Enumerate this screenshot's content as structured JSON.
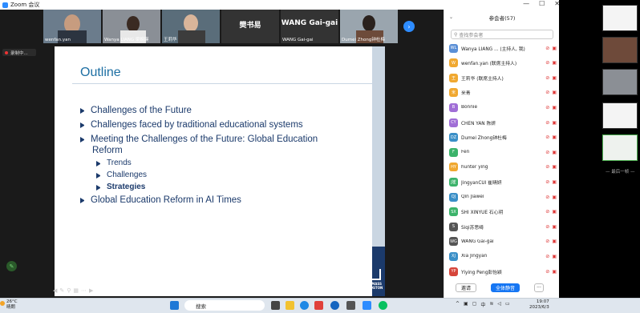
{
  "window": {
    "title": "Zoom 会议",
    "minimize": "—",
    "maximize": "☐",
    "close": "✕"
  },
  "videos": [
    {
      "name": "wenfan.yan",
      "bg": "#6b7c8c"
    },
    {
      "name": "Wanya LIANG 梁婉瑛",
      "bg": "#8a8f96"
    },
    {
      "name": "王莉华",
      "bg": "#5a6d7a"
    },
    {
      "name": "樊书易",
      "bg": "#333",
      "big": "樊书易"
    },
    {
      "name": "WANG Gai-gai",
      "bg": "#333",
      "big": "WANG Gai-gai"
    },
    {
      "name": "Dumei Zhong钟杜梅",
      "bg": "#9aa5ae"
    }
  ],
  "recording": "录制中...",
  "slide": {
    "title": "Outline",
    "bullets": [
      "Challenges of the Future",
      "Challenges faced by traditional educational systems",
      "Meeting the Challenges of the Future: Global Education",
      "Reform",
      "Global Education Reform in AI Times"
    ],
    "sub": [
      "Trends",
      "Challenges",
      "Strategies"
    ],
    "logo": "UMASS BOSTON"
  },
  "participants_panel": {
    "title": "参会者(57)",
    "search_placeholder": "查找参会者",
    "invite": "邀请",
    "mute_all": "全体静音",
    "more": "···"
  },
  "participants": [
    {
      "initials": "WL",
      "color": "#5a8fd6",
      "name": "Wanya LIANG ... (主持人, 我)"
    },
    {
      "initials": "W",
      "color": "#f0a830",
      "name": "wenfan.yan (联席主持人)"
    },
    {
      "initials": "王",
      "color": "#f0a830",
      "name": "王莉华 (联席主持人)"
    },
    {
      "initials": "米",
      "color": "#f0a830",
      "name": "米青"
    },
    {
      "initials": "B",
      "color": "#a06ed6",
      "name": "Bonnie"
    },
    {
      "initials": "CY",
      "color": "#a06ed6",
      "name": "CHEN YAN 陈妍"
    },
    {
      "initials": "DZ",
      "color": "#3a8fc7",
      "name": "Dumei Zhong钟杜梅"
    },
    {
      "initials": "F",
      "color": "#3bb36a",
      "name": "Fen"
    },
    {
      "initials": "HY",
      "color": "#f0a830",
      "name": "hunter ying"
    },
    {
      "initials": "J崔",
      "color": "#3bb36a",
      "name": "JingyanCUI 崔晴妍"
    },
    {
      "initials": "QJ",
      "color": "#3a8fc7",
      "name": "Qin Jiawei"
    },
    {
      "initials": "SX",
      "color": "#3bb36a",
      "name": "SHI XINYUE 石心玥"
    },
    {
      "initials": "S",
      "color": "#555",
      "name": "Siqi苏思绮"
    },
    {
      "initials": "WG",
      "color": "#555",
      "name": "WANG Gai-gai"
    },
    {
      "initials": "XJ",
      "color": "#3a8fc7",
      "name": "Xia Jingyan"
    },
    {
      "initials": "YP",
      "color": "#d6453a",
      "name": "Yiying Peng彭怡颖"
    }
  ],
  "desktop_strip": {
    "end_label": "— 最后一帧 —"
  },
  "taskbar": {
    "weather_temp": "26°C",
    "weather_desc": "晴朗",
    "search": "搜索",
    "input_method": "中",
    "time": "19:07",
    "date": "2023/6/3"
  }
}
